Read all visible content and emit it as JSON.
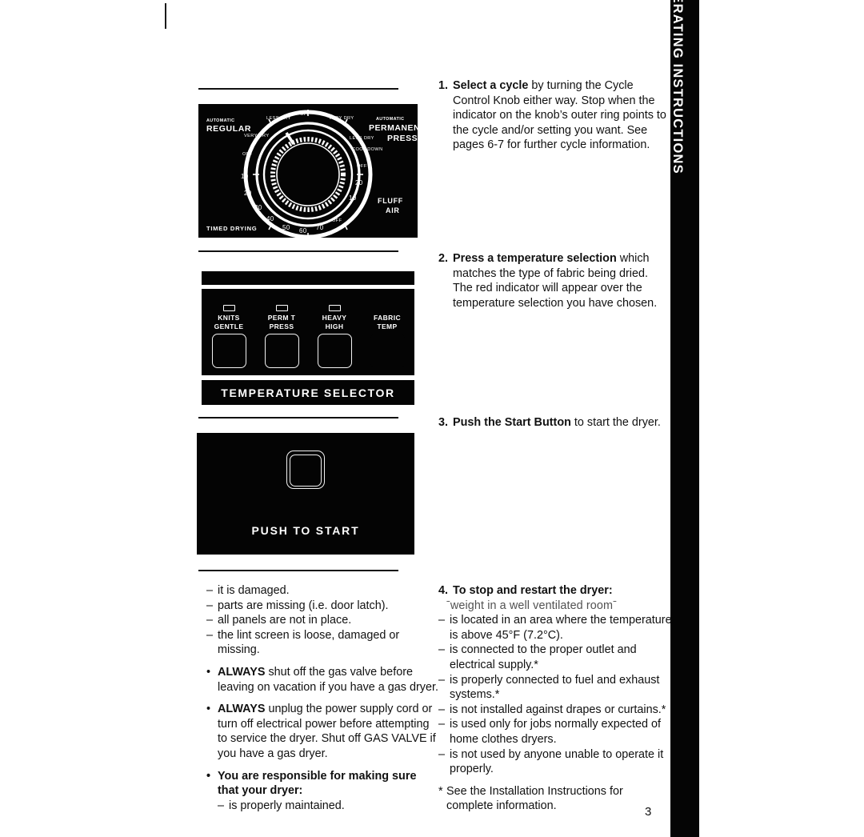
{
  "page": {
    "number": "3",
    "side_tab_label": "OPERATING INSTRUCTIONS"
  },
  "figures": {
    "knob": {
      "name": "cycle-control-knob",
      "labels": {
        "auto_left_small": "AUTOMATIC",
        "auto_left_big": "REGULAR",
        "auto_right_small": "AUTOMATIC",
        "auto_right_big1": "PERMANENT",
        "auto_right_big2": "PRESS",
        "timed_drying": "TIMED DRYING",
        "fluff1": "FLUFF",
        "fluff2": "AIR",
        "off_top": "OFF",
        "less_dry_left": "LESS DRY",
        "very_dry_left": "VERY DRY",
        "off_left": "OFF",
        "very_dry_right": "VERY DRY",
        "less_dry_right": "LESS DRY",
        "cool_down": "COOL DOWN",
        "off_right": "OFF",
        "off_bottom": "OFF",
        "t10_right": "10",
        "t20_right": "20",
        "t10_left": "10",
        "t20_left": "20",
        "t30": "30",
        "t40": "40",
        "t50": "50",
        "t60": "60",
        "t70": "70"
      }
    },
    "temperature_selector": {
      "name": "temperature-selector-panel",
      "columns": [
        {
          "line1": "KNITS",
          "line2": "GENTLE",
          "has_led": true,
          "has_button": true
        },
        {
          "line1": "PERM T",
          "line2": "PRESS",
          "has_led": true,
          "has_button": true
        },
        {
          "line1": "HEAVY",
          "line2": "HIGH",
          "has_led": true,
          "has_button": true
        },
        {
          "line1": "FABRIC",
          "line2": "TEMP",
          "has_led": false,
          "has_button": false
        }
      ],
      "caption": "TEMPERATURE SELECTOR"
    },
    "start_button_panel": {
      "name": "push-to-start-panel",
      "label": "PUSH TO START"
    }
  },
  "steps": [
    {
      "num": "1.",
      "lead": "Select a cycle",
      "rest": " by turning the Cycle Control Knob either way. Stop when the indicator on the knob’s outer ring points to the cycle and/or setting you want. See pages 6-7 for further cycle information."
    },
    {
      "num": "2.",
      "lead": "Press a temperature selection",
      "rest": " which matches the type of fabric being dried. The red indicator will appear over the temperature selection you have chosen."
    },
    {
      "num": "3.",
      "lead": "Push the Start Button",
      "rest": " to start the dryer."
    }
  ],
  "left_column": {
    "items": [
      {
        "type": "dash",
        "mark": "–",
        "text": "it is damaged."
      },
      {
        "type": "dash",
        "mark": "–",
        "text": "parts are missing (i.e. door latch)."
      },
      {
        "type": "dash",
        "mark": "–",
        "text": "all panels are not in place."
      },
      {
        "type": "dash",
        "mark": "–",
        "text": "the lint screen is loose, damaged or missing."
      },
      {
        "type": "bullet",
        "mark": "•",
        "bold_lead": "ALWAYS",
        "text": " shut off the gas valve before leaving on vacation if you have a gas dryer."
      },
      {
        "type": "bullet",
        "mark": "•",
        "bold_lead": "ALWAYS",
        "text": " unplug the power supply cord or turn off electrical power before attempting to service the dryer. Shut off GAS VALVE if you have a gas dryer."
      },
      {
        "type": "bullet-bold",
        "mark": "•",
        "text": "You are responsible for making sure that your dryer:"
      },
      {
        "type": "dash",
        "mark": "–",
        "text": "is properly maintained."
      }
    ]
  },
  "right_column": {
    "heading_num": "4.",
    "heading": "To stop and restart the dryer:",
    "artifact_line": "ˉweight in a well ventilated roomˉ",
    "items": [
      {
        "mark": "–",
        "text": "is located in an area where the temperature is above 45°F (7.2°C)."
      },
      {
        "mark": "–",
        "text": "is connected to the proper outlet and electrical supply.*"
      },
      {
        "mark": "–",
        "text": "is properly connected to fuel and exhaust systems.*"
      },
      {
        "mark": "–",
        "text": "is not installed against drapes or curtains.*"
      },
      {
        "mark": "–",
        "text": "is used only for jobs normally expected of home clothes dryers."
      },
      {
        "mark": "–",
        "text": "is not used by anyone unable to operate it properly."
      }
    ],
    "footnote_mark": "*",
    "footnote": "See the Installation Instructions for complete information."
  }
}
